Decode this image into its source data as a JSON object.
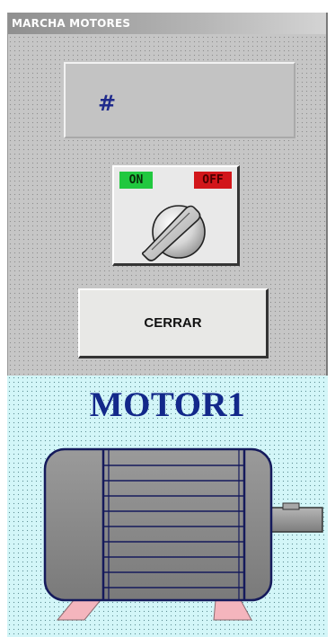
{
  "window": {
    "title": "MARCHA MOTORES",
    "display_value": "#",
    "switch": {
      "on_label": "ON",
      "off_label": "OFF"
    },
    "close_button_label": "CERRAR"
  },
  "motor": {
    "title": "MOTOR1"
  },
  "colors": {
    "window_bg": "#c6c6c6",
    "display_text": "#1f2a8c",
    "on_label_bg": "#21c83f",
    "off_label_bg": "#d2161a",
    "motor_panel_bg": "#d3f6f8",
    "motor_title": "#13288a",
    "motor_body": "#8c8c8c",
    "motor_outline": "#151a5c",
    "motor_feet": "#f4b5bd"
  },
  "icons": {
    "selector_knob": "rotary-selector-knob-icon",
    "motor": "electric-motor-icon"
  }
}
